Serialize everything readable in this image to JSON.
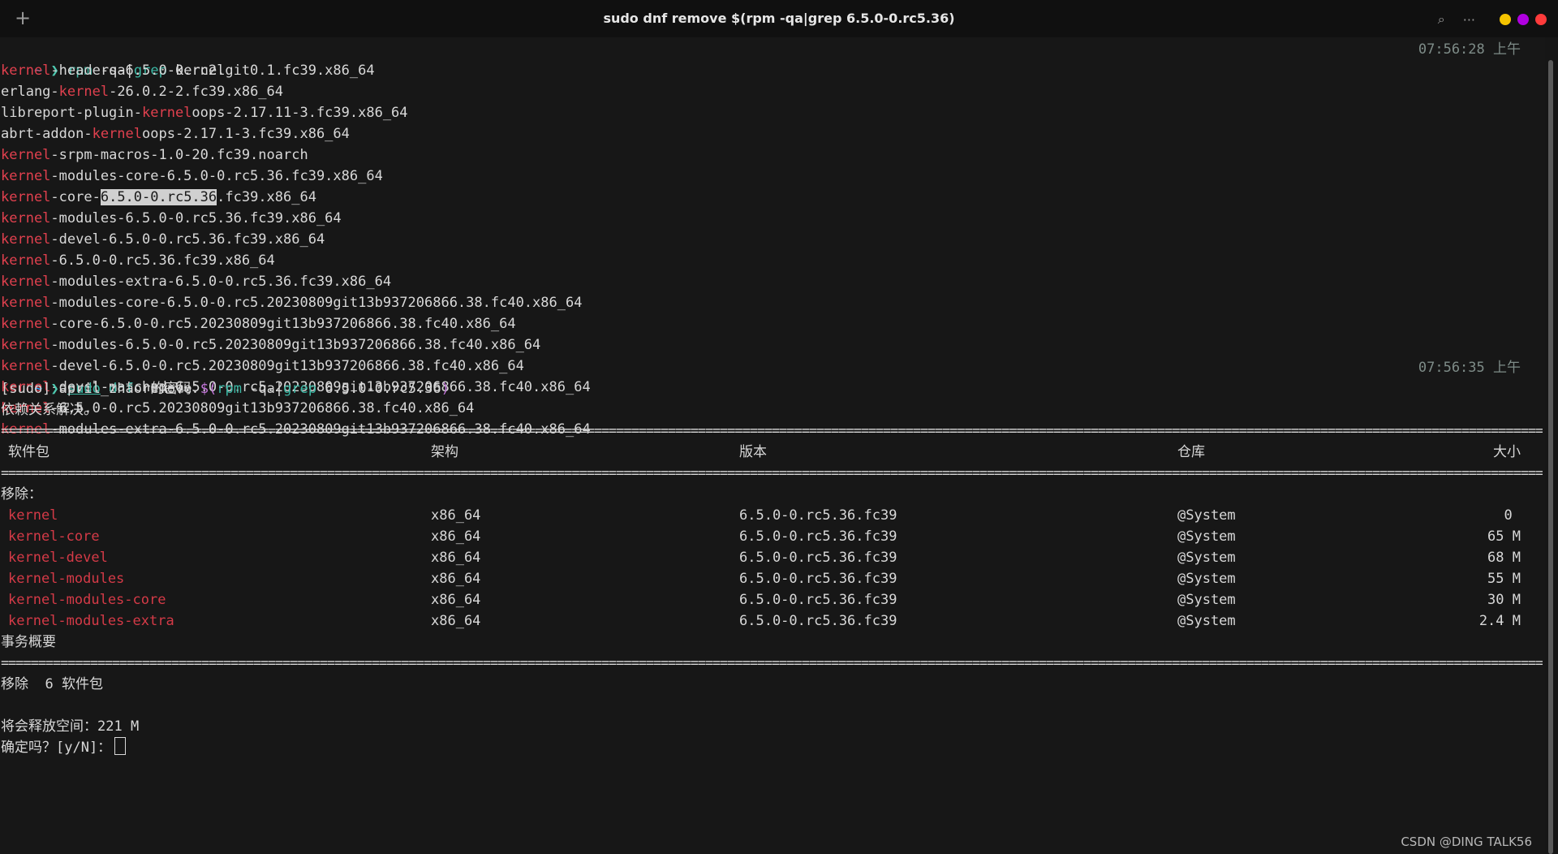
{
  "window": {
    "title": "sudo dnf remove $(rpm -qa|grep 6.5.0-0.rc5.36)",
    "new_tab_glyph": "+",
    "search_glyph": "⌕",
    "menu_glyph": "···",
    "controls": {
      "minimize": "#f5c400",
      "maximize": "#b000e0",
      "close": "#ff3b3b"
    }
  },
  "prompt1": {
    "tilde": "~",
    "arrow": "❯",
    "cmd": "rpm",
    "args1": " -qa",
    "pipe": "|",
    "grep": "grep",
    "args2": " kernel",
    "time": "07:56:28 上午"
  },
  "rpm_results": [
    {
      "pre": "",
      "match": "kernel",
      "post": "-headers-6.5.0-0.rc2.git0.1.fc39.x86_64"
    },
    {
      "pre": "erlang-",
      "match": "kernel",
      "post": "-26.0.2-2.fc39.x86_64"
    },
    {
      "pre": "libreport-plugin-",
      "match": "kernel",
      "post": "oops-2.17.11-3.fc39.x86_64"
    },
    {
      "pre": "abrt-addon-",
      "match": "kernel",
      "post": "oops-2.17.1-3.fc39.x86_64"
    },
    {
      "pre": "",
      "match": "kernel",
      "post": "-srpm-macros-1.0-20.fc39.noarch"
    },
    {
      "pre": "",
      "match": "kernel",
      "post": "-modules-core-6.5.0-0.rc5.36.fc39.x86_64"
    },
    {
      "pre": "",
      "match": "kernel",
      "post_a": "-core-",
      "selected": "6.5.0-0.rc5.36",
      "post": ".fc39.x86_64"
    },
    {
      "pre": "",
      "match": "kernel",
      "post": "-modules-6.5.0-0.rc5.36.fc39.x86_64"
    },
    {
      "pre": "",
      "match": "kernel",
      "post": "-devel-6.5.0-0.rc5.36.fc39.x86_64"
    },
    {
      "pre": "",
      "match": "kernel",
      "post": "-6.5.0-0.rc5.36.fc39.x86_64"
    },
    {
      "pre": "",
      "match": "kernel",
      "post": "-modules-extra-6.5.0-0.rc5.36.fc39.x86_64"
    },
    {
      "pre": "",
      "match": "kernel",
      "post": "-modules-core-6.5.0-0.rc5.20230809git13b937206866.38.fc40.x86_64"
    },
    {
      "pre": "",
      "match": "kernel",
      "post": "-core-6.5.0-0.rc5.20230809git13b937206866.38.fc40.x86_64"
    },
    {
      "pre": "",
      "match": "kernel",
      "post": "-modules-6.5.0-0.rc5.20230809git13b937206866.38.fc40.x86_64"
    },
    {
      "pre": "",
      "match": "kernel",
      "post": "-devel-6.5.0-0.rc5.20230809git13b937206866.38.fc40.x86_64"
    },
    {
      "pre": "",
      "match": "kernel",
      "post": "-devel-matched-6.5.0-0.rc5.20230809git13b937206866.38.fc40.x86_64"
    },
    {
      "pre": "",
      "match": "kernel",
      "post": "-6.5.0-0.rc5.20230809git13b937206866.38.fc40.x86_64"
    },
    {
      "pre": "",
      "match": "kernel",
      "post": "-modules-extra-6.5.0-0.rc5.20230809git13b937206866.38.fc40.x86_64"
    }
  ],
  "prompt2": {
    "tilde": "~",
    "arrow": "❯",
    "sudo": "sudo",
    "dnf": "dnf",
    "remove": " remove ",
    "subst_open": "$(",
    "rpm": "rpm",
    "args1": " -qa",
    "pipe": "|",
    "grep": "grep",
    "args2": " 6.5.0-0.rc5.36",
    "subst_close": ")",
    "time": "07:56:35 上午"
  },
  "sudo_prompt": "[sudo] april_zhao 的密码：",
  "deps_resolved": "依赖关系解决。",
  "separator": "================================================================================================================================================================================================================================",
  "table": {
    "headers": {
      "package": "软件包",
      "arch": "架构",
      "version": "版本",
      "repo": "仓库",
      "size": "大小"
    },
    "section": "移除：",
    "rows": [
      {
        "package": "kernel",
        "arch": "x86_64",
        "version": "6.5.0-0.rc5.36.fc39",
        "repo": "@System",
        "size": "0 "
      },
      {
        "package": "kernel-core",
        "arch": "x86_64",
        "version": "6.5.0-0.rc5.36.fc39",
        "repo": "@System",
        "size": "65 M"
      },
      {
        "package": "kernel-devel",
        "arch": "x86_64",
        "version": "6.5.0-0.rc5.36.fc39",
        "repo": "@System",
        "size": "68 M"
      },
      {
        "package": "kernel-modules",
        "arch": "x86_64",
        "version": "6.5.0-0.rc5.36.fc39",
        "repo": "@System",
        "size": "55 M"
      },
      {
        "package": "kernel-modules-core",
        "arch": "x86_64",
        "version": "6.5.0-0.rc5.36.fc39",
        "repo": "@System",
        "size": "30 M"
      },
      {
        "package": "kernel-modules-extra",
        "arch": "x86_64",
        "version": "6.5.0-0.rc5.36.fc39",
        "repo": "@System",
        "size": "2.4 M"
      }
    ]
  },
  "summary": {
    "title": "事务概要",
    "remove_line": "移除  6 软件包",
    "freed": "将会释放空间：221 M",
    "confirm": "确定吗？[y/N]："
  },
  "watermark": "CSDN @DING TALK56"
}
